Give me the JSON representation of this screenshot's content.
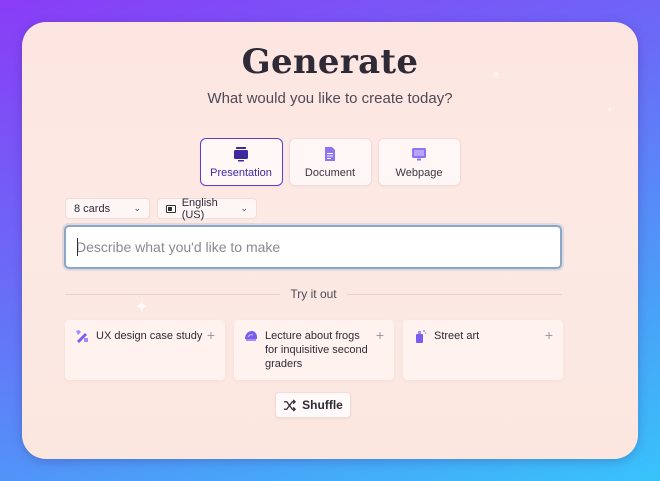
{
  "header": {
    "title": "Generate",
    "subtitle": "What would you like to create today?"
  },
  "types": [
    {
      "label": "Presentation",
      "icon": "presentation-icon",
      "active": true
    },
    {
      "label": "Document",
      "icon": "document-icon",
      "active": false
    },
    {
      "label": "Webpage",
      "icon": "webpage-icon",
      "active": false
    }
  ],
  "controls": {
    "cards_value": "8 cards",
    "language_value": "English (US)"
  },
  "prompt": {
    "placeholder": "Describe what you'd like to make",
    "value": ""
  },
  "try_label": "Try it out",
  "examples": [
    {
      "text": "UX design case study",
      "icon": "design-tools-icon"
    },
    {
      "text": "Lecture about frogs for inquisitive second graders",
      "icon": "brain-icon"
    },
    {
      "text": "Street art",
      "icon": "spray-can-icon"
    }
  ],
  "shuffle_label": "Shuffle",
  "colors": {
    "accent": "#5b3fd0",
    "icon_purple": "#7b5cf0"
  }
}
